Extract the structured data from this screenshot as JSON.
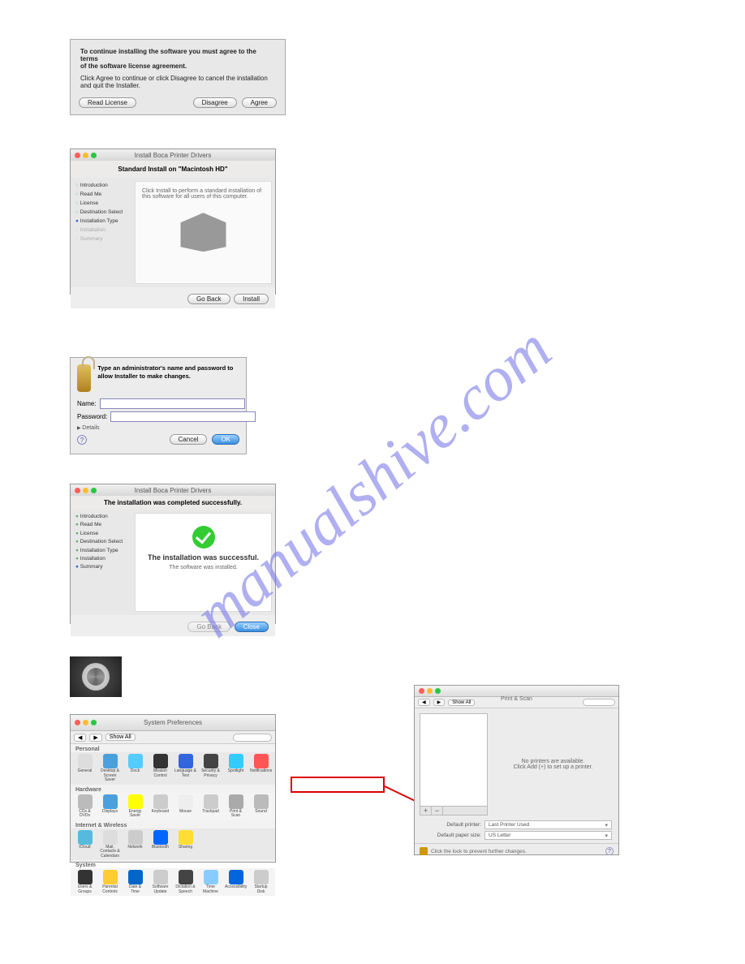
{
  "watermark": "manualshive.com",
  "dlg1": {
    "bold1": "To continue installing the software you must agree to the terms",
    "bold2": "of the software license agreement.",
    "line1": "Click Agree to continue or click Disagree to cancel the installation",
    "line2": "and quit the Installer.",
    "read_license": "Read License",
    "disagree": "Disagree",
    "agree": "Agree"
  },
  "dlg2": {
    "title": "Install Boca Printer Drivers",
    "heading": "Standard Install on \"Macintosh HD\"",
    "steps": {
      "s1": "Introduction",
      "s2": "Read Me",
      "s3": "License",
      "s4": "Destination Select",
      "s5": "Installation Type",
      "s6": "Installation",
      "s7": "Summary"
    },
    "body_text": "Click Install to perform a standard installation of this software for all users of this computer.",
    "go_back": "Go Back",
    "install": "Install"
  },
  "dlg3": {
    "msg": "Type an administrator's name and password to allow Installer to make changes.",
    "name_label": "Name:",
    "pass_label": "Password:",
    "name_value": "",
    "pass_value": "",
    "details": "Details",
    "cancel": "Cancel",
    "ok": "OK"
  },
  "dlg4": {
    "title": "Install Boca Printer Drivers",
    "heading": "The installation was completed successfully.",
    "steps": {
      "s1": "Introduction",
      "s2": "Read Me",
      "s3": "License",
      "s4": "Destination Select",
      "s5": "Installation Type",
      "s6": "Installation",
      "s7": "Summary"
    },
    "msg1": "The installation was successful.",
    "msg2": "The software was installed.",
    "go_back": "Go Back",
    "close": "Close"
  },
  "sysprefs": {
    "title": "System Preferences",
    "show_all": "Show All",
    "sections": {
      "personal": "Personal",
      "hardware": "Hardware",
      "internet": "Internet & Wireless",
      "system": "System"
    },
    "items": {
      "general": "General",
      "desktop": "Desktop & Screen Saver",
      "dock": "Dock",
      "mission": "Mission Control",
      "lang": "Language & Text",
      "sec": "Security & Privacy",
      "spot": "Spotlight",
      "not": "Notifications",
      "cd": "CDs & DVDs",
      "disp": "Displays",
      "energy": "Energy Saver",
      "kb": "Keyboard",
      "mouse": "Mouse",
      "track": "Trackpad",
      "print": "Print & Scan",
      "sound": "Sound",
      "cloud": "iCloud",
      "mail": "Mail, Contacts & Calendars",
      "net": "Network",
      "bt": "Bluetooth",
      "share": "Sharing",
      "users": "Users & Groups",
      "parent": "Parental Controls",
      "date": "Date & Time",
      "su": "Software Update",
      "dict": "Dictation & Speech",
      "tm": "Time Machine",
      "acc": "Accessibility",
      "start": "Startup Disk"
    }
  },
  "printscan": {
    "title": "Print & Scan",
    "show_all": "Show All",
    "no_printers": "No printers are available.",
    "add_hint": "Click Add (+) to set up a printer.",
    "add": "+",
    "rem": "−",
    "def_printer_label": "Default printer:",
    "def_printer_value": "Last Printer Used",
    "def_paper_label": "Default paper size:",
    "def_paper_value": "US Letter",
    "lock_text": "Click the lock to prevent further changes."
  }
}
